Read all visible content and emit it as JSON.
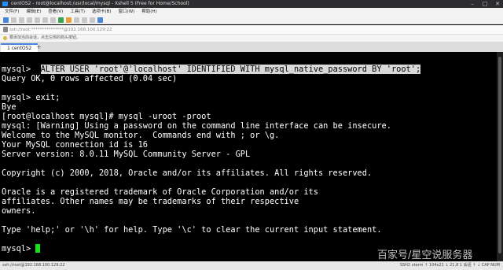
{
  "window": {
    "title": "centOS2 - root@localhost:/usr/local/mysql - Xshell 5 (Free for Home/School)"
  },
  "menu": [
    "文件(F)",
    "编辑(E)",
    "查看(V)",
    "工具(T)",
    "选项卡(B)",
    "窗口(W)",
    "帮助(H)"
  ],
  "address": {
    "value": "ssh://root:***************@192.168.100.129:22"
  },
  "hint": {
    "text": "要添加当前会话，点击左侧的箭头按钮。"
  },
  "tab": {
    "label": "1 centOS2",
    "add": "+"
  },
  "terminal": {
    "lines": [
      "mysql>  ALTER USER 'root'@'localhost' IDENTIFIED WITH mysql_native_password BY 'root';",
      "Query OK, 0 rows affected (0.04 sec)",
      "",
      "mysql> exit;",
      "Bye",
      "[root@localhost mysql]# mysql -uroot -proot",
      "mysql: [Warning] Using a password on the command line interface can be insecure.",
      "Welcome to the MySQL monitor.  Commands end with ; or \\g.",
      "Your MySQL connection id is 16",
      "Server version: 8.0.11 MySQL Community Server - GPL",
      "",
      "Copyright (c) 2000, 2018, Oracle and/or its affiliates. All rights reserved.",
      "",
      "Oracle is a registered trademark of Oracle Corporation and/or its",
      "affiliates. Other names may be trademarks of their respective",
      "owners.",
      "",
      "Type 'help;' or '\\h' for help. Type '\\c' to clear the current input statement.",
      ""
    ],
    "highlight_prefix": "mysql>  ",
    "highlight_text": "ALTER USER 'root'@'localhost' IDENTIFIED WITH mysql_native_password BY 'root';",
    "prompt": "mysql> "
  },
  "status": {
    "left": "ssh://root@192.168.100.129:22",
    "right": "SSH2   xterm   ↑ 104x21   ↓ 21,8   1 会话   ↑   ↓   CAP NUM"
  },
  "watermark": "百家号/星空说服务器",
  "colors": {
    "terminal_bg": "#000000",
    "terminal_fg": "#ffffff",
    "cursor": "#15e515",
    "highlight_bg": "#d8d8d8"
  }
}
